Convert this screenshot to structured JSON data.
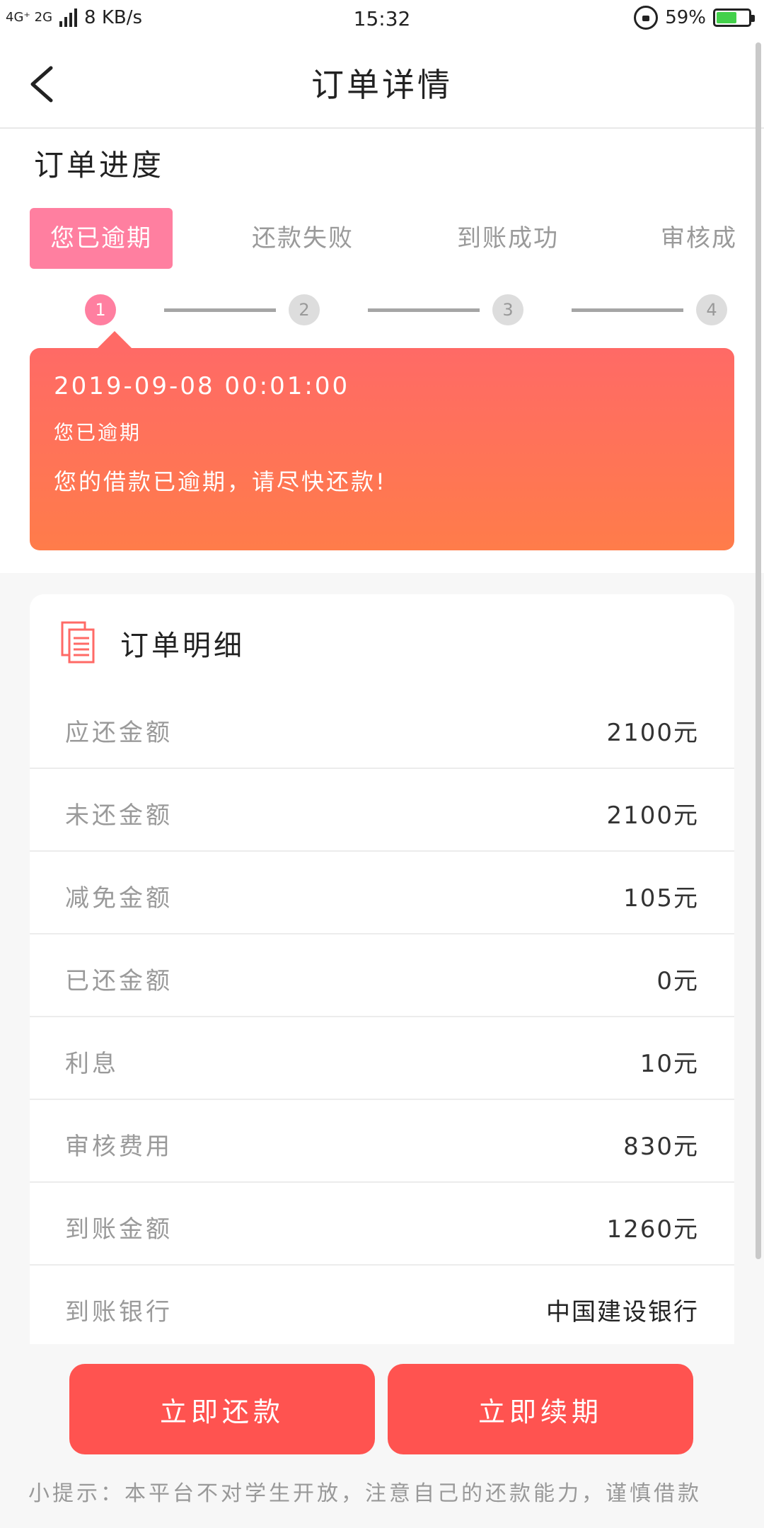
{
  "status_bar": {
    "network": "4G⁺ 2G",
    "speed": "8 KB/s",
    "time": "15:32",
    "battery": "59%",
    "battery_level": 0.59
  },
  "header": {
    "title": "订单详情"
  },
  "progress": {
    "section_title": "订单进度",
    "steps": [
      {
        "label": "您已逾期",
        "num": "1"
      },
      {
        "label": "还款失败",
        "num": "2"
      },
      {
        "label": "到账成功",
        "num": "3"
      },
      {
        "label": "审核成",
        "num": "4"
      }
    ],
    "card": {
      "date": "2019-09-08 00:01:00",
      "status": "您已逾期",
      "message": "您的借款已逾期，请尽快还款!"
    }
  },
  "details": {
    "title": "订单明细",
    "rows": [
      {
        "label": "应还金额",
        "value": "2100元"
      },
      {
        "label": "未还金额",
        "value": "2100元"
      },
      {
        "label": "减免金额",
        "value": "105元"
      },
      {
        "label": "已还金额",
        "value": "0元"
      },
      {
        "label": "利息",
        "value": "10元"
      },
      {
        "label": "审核费用",
        "value": "830元"
      },
      {
        "label": "到账金额",
        "value": "1260元"
      },
      {
        "label": "到账银行",
        "value": "中国建设银行"
      }
    ]
  },
  "actions": {
    "repay_label": "立即还款",
    "extend_label": "立即续期",
    "tip": "小提示：本平台不对学生开放，注意自己的还款能力，谨慎借款"
  },
  "colors": {
    "accent_pink": "#ff7fa0",
    "card_gradient_top": "#ff6a66",
    "card_gradient_bottom": "#ff7c4a",
    "button_red": "#ff5350"
  }
}
